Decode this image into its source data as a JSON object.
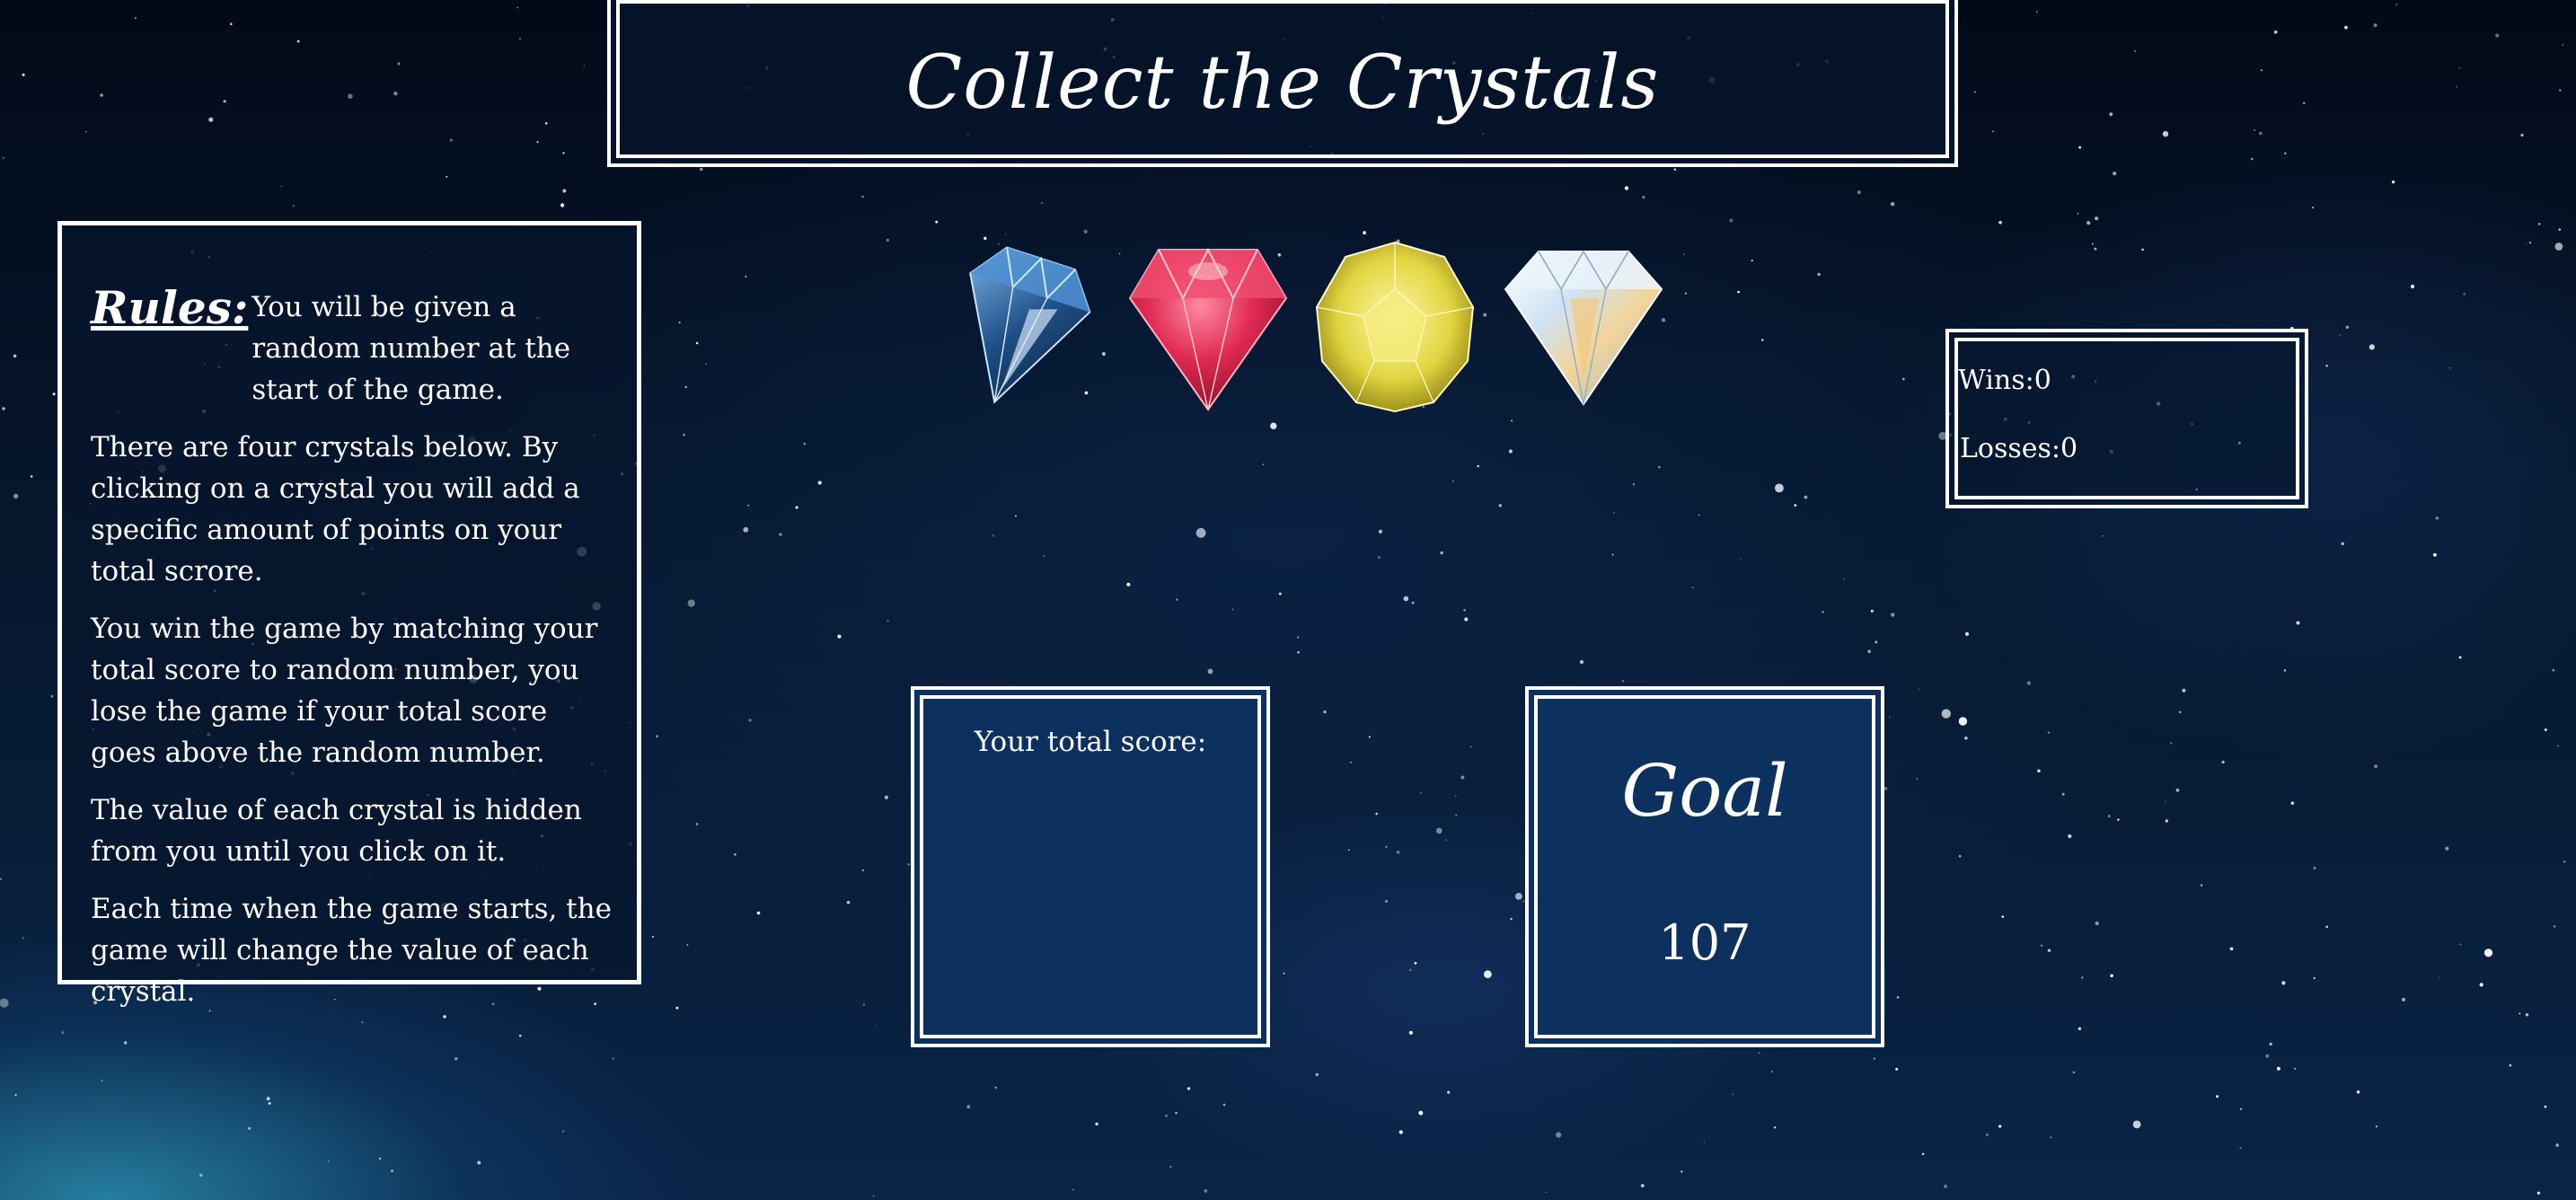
{
  "title": "Collect the Crystals",
  "rules": {
    "heading": "Rules:",
    "paragraphs": [
      "You will be given a random number at the start of the game.",
      "There are four crystals below. By clicking on a crystal you will add a specific amount of points on your total scrore.",
      "You win the game by matching your total score to random number, you lose the game if your total score goes above the random number.",
      "The value of each crystal is hidden from you until you click on it.",
      "Each time when the game starts, the game will change the value of each crystal."
    ]
  },
  "crystals": [
    {
      "name": "blue-crystal",
      "color": "#2a6fb0"
    },
    {
      "name": "red-crystal",
      "color": "#d6264a"
    },
    {
      "name": "yellow-crystal",
      "color": "#e1d84a"
    },
    {
      "name": "white-crystal",
      "color": "#e8eef5"
    }
  ],
  "stats": {
    "wins_label": "Wins:",
    "wins_value": "0",
    "losses_label": "Losses:",
    "losses_value": "0"
  },
  "score": {
    "label": "Your total score:",
    "value": ""
  },
  "goal": {
    "label": "Goal",
    "value": "107"
  },
  "colors": {
    "panel_bg": "#0d315f",
    "border": "#ffffff",
    "space_bg": "#041426"
  }
}
